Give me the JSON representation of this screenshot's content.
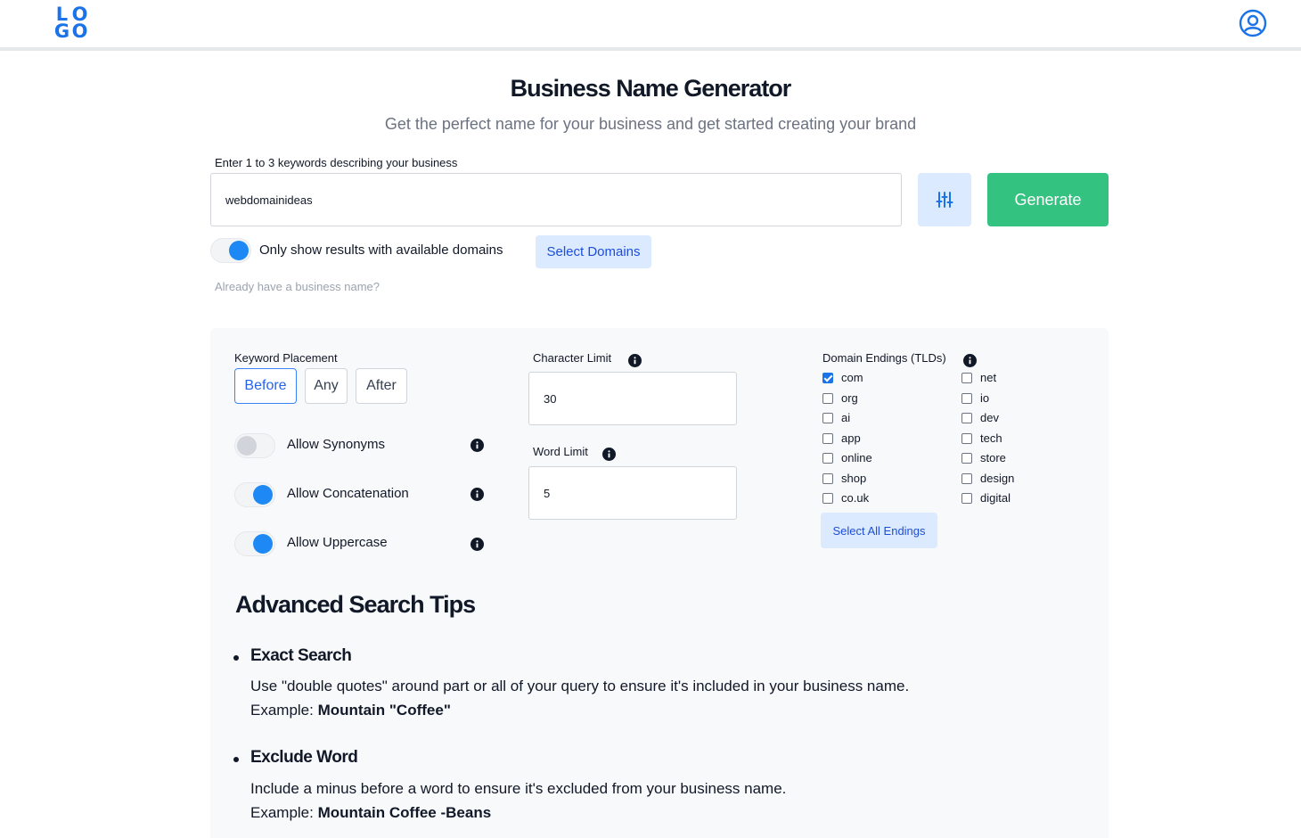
{
  "header": {
    "logo_letters": [
      "L",
      "O",
      "G",
      "O"
    ],
    "user_icon": "user-circle-icon"
  },
  "hero": {
    "title": "Business Name Generator",
    "subtitle": "Get the perfect name for your business and get started creating your brand"
  },
  "search": {
    "label": "Enter 1 to 3 keywords describing your business",
    "value": "webdomainideas",
    "filter_icon": "sliders-icon",
    "generate_label": "Generate"
  },
  "availability": {
    "toggle_on": true,
    "label": "Only show results with available domains",
    "select_domains_label": "Select Domains",
    "already_label": "Already have a business name?"
  },
  "options": {
    "keyword_placement": {
      "label": "Keyword Placement",
      "choices": [
        "Before",
        "Any",
        "After"
      ],
      "selected": "Before"
    },
    "toggles": [
      {
        "label": "Allow Synonyms",
        "on": false
      },
      {
        "label": "Allow Concatenation",
        "on": true
      },
      {
        "label": "Allow Uppercase",
        "on": true
      }
    ],
    "character_limit": {
      "label": "Character Limit",
      "value": "30"
    },
    "word_limit": {
      "label": "Word Limit",
      "value": "5"
    },
    "tlds": {
      "label": "Domain Endings (TLDs)",
      "left": [
        {
          "name": "com",
          "checked": true
        },
        {
          "name": "org",
          "checked": false
        },
        {
          "name": "ai",
          "checked": false
        },
        {
          "name": "app",
          "checked": false
        },
        {
          "name": "online",
          "checked": false
        },
        {
          "name": "shop",
          "checked": false
        },
        {
          "name": "co.uk",
          "checked": false
        }
      ],
      "right": [
        {
          "name": "net",
          "checked": false
        },
        {
          "name": "io",
          "checked": false
        },
        {
          "name": "dev",
          "checked": false
        },
        {
          "name": "tech",
          "checked": false
        },
        {
          "name": "store",
          "checked": false
        },
        {
          "name": "design",
          "checked": false
        },
        {
          "name": "digital",
          "checked": false
        }
      ],
      "select_all_label": "Select All Endings"
    }
  },
  "tips": {
    "title": "Advanced Search Tips",
    "items": [
      {
        "heading": "Exact Search",
        "text": "Use \"double quotes\" around part or all of your query to ensure it's included in your business name.",
        "example_label": "Example:",
        "example_value": "Mountain \"Coffee\""
      },
      {
        "heading": "Exclude Word",
        "text": "Include a minus before a word to ensure it's excluded from your business name.",
        "example_label": "Example:",
        "example_value": "Mountain Coffee -Beans"
      }
    ]
  },
  "colors": {
    "accent": "#1a73e8",
    "generate": "#34c281",
    "light_blue": "#dbeafe"
  }
}
